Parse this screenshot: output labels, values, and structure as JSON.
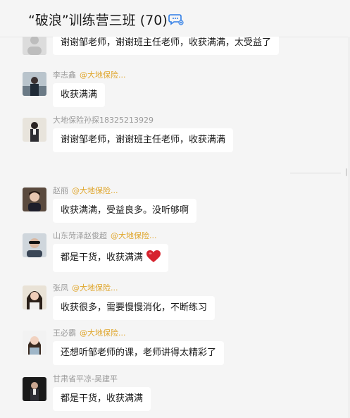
{
  "header": {
    "title": "“破浪”训练营三班 (70)",
    "members_icon": "group-members-icon"
  },
  "messages": [
    {
      "sender": "",
      "tag": "",
      "text": "谢谢邹老师，谢谢班主任老师，收获满满，太受益了"
    },
    {
      "sender": "李志鑫",
      "tag": "@大地保险...",
      "text": "收获满满"
    },
    {
      "sender": "大地保险孙探18325213929",
      "tag": "",
      "text": "谢谢邹老师，谢谢班主任老师，收获满满"
    },
    {
      "sender": "赵丽",
      "tag": "@大地保险...",
      "text": "收获满满，受益良多。没听够啊"
    },
    {
      "sender": "山东菏泽赵俊超",
      "tag": "@大地保险...",
      "text": "都是干货，收获满满",
      "emoji": "heart-emoji"
    },
    {
      "sender": "张凤",
      "tag": "@大地保险...",
      "text": "收获很多，需要慢慢消化，不断练习"
    },
    {
      "sender": "王必霸",
      "tag": "@大地保险...",
      "text": "还想听邹老师的课，老师讲得太精彩了"
    },
    {
      "sender": "甘肃省平凉-吴建平",
      "tag": "",
      "text": "都是干货，收获满满"
    }
  ],
  "colors": {
    "background": "#f5f5f5",
    "bubble": "#ffffff",
    "tag": "#e0a62c",
    "sender": "#9a9a9a"
  }
}
